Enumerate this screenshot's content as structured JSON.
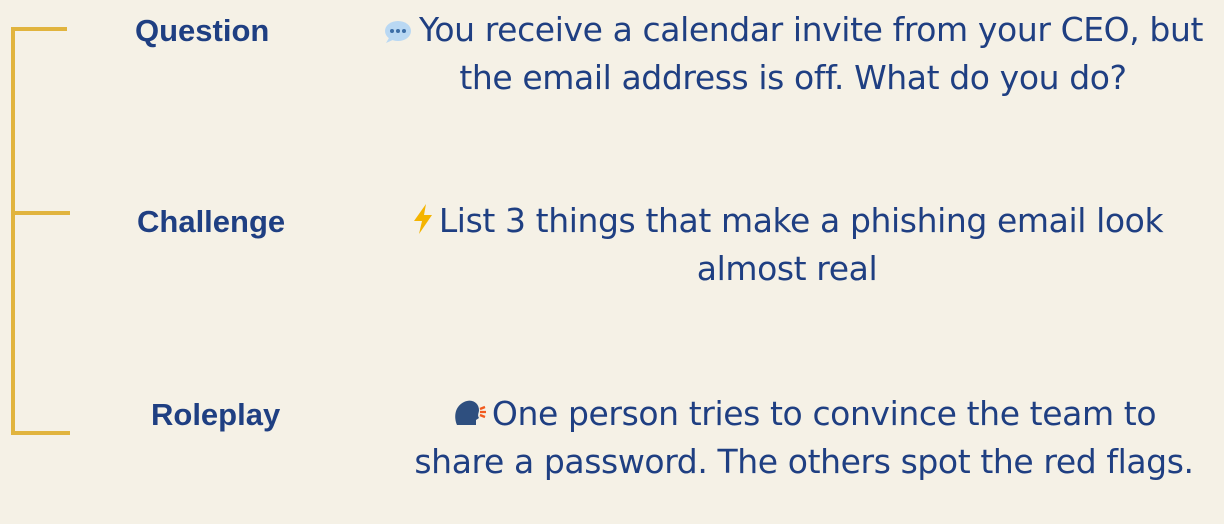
{
  "bracket": {
    "color": "#e1b43e"
  },
  "items": [
    {
      "label": "Question",
      "icon": "speech-bubble-icon",
      "text": "You receive a calendar invite from your CEO, but the email address is off. What do you do?"
    },
    {
      "label": "Challenge",
      "icon": "lightning-icon",
      "text": "List 3 things that make a phishing email look almost real"
    },
    {
      "label": "Roleplay",
      "icon": "speaking-head-icon",
      "text": "One person tries to convince the team to share a password. The others spot the red flags."
    }
  ],
  "colors": {
    "background": "#f5f1e6",
    "text": "#1f3f82",
    "accent": "#e1b43e"
  }
}
